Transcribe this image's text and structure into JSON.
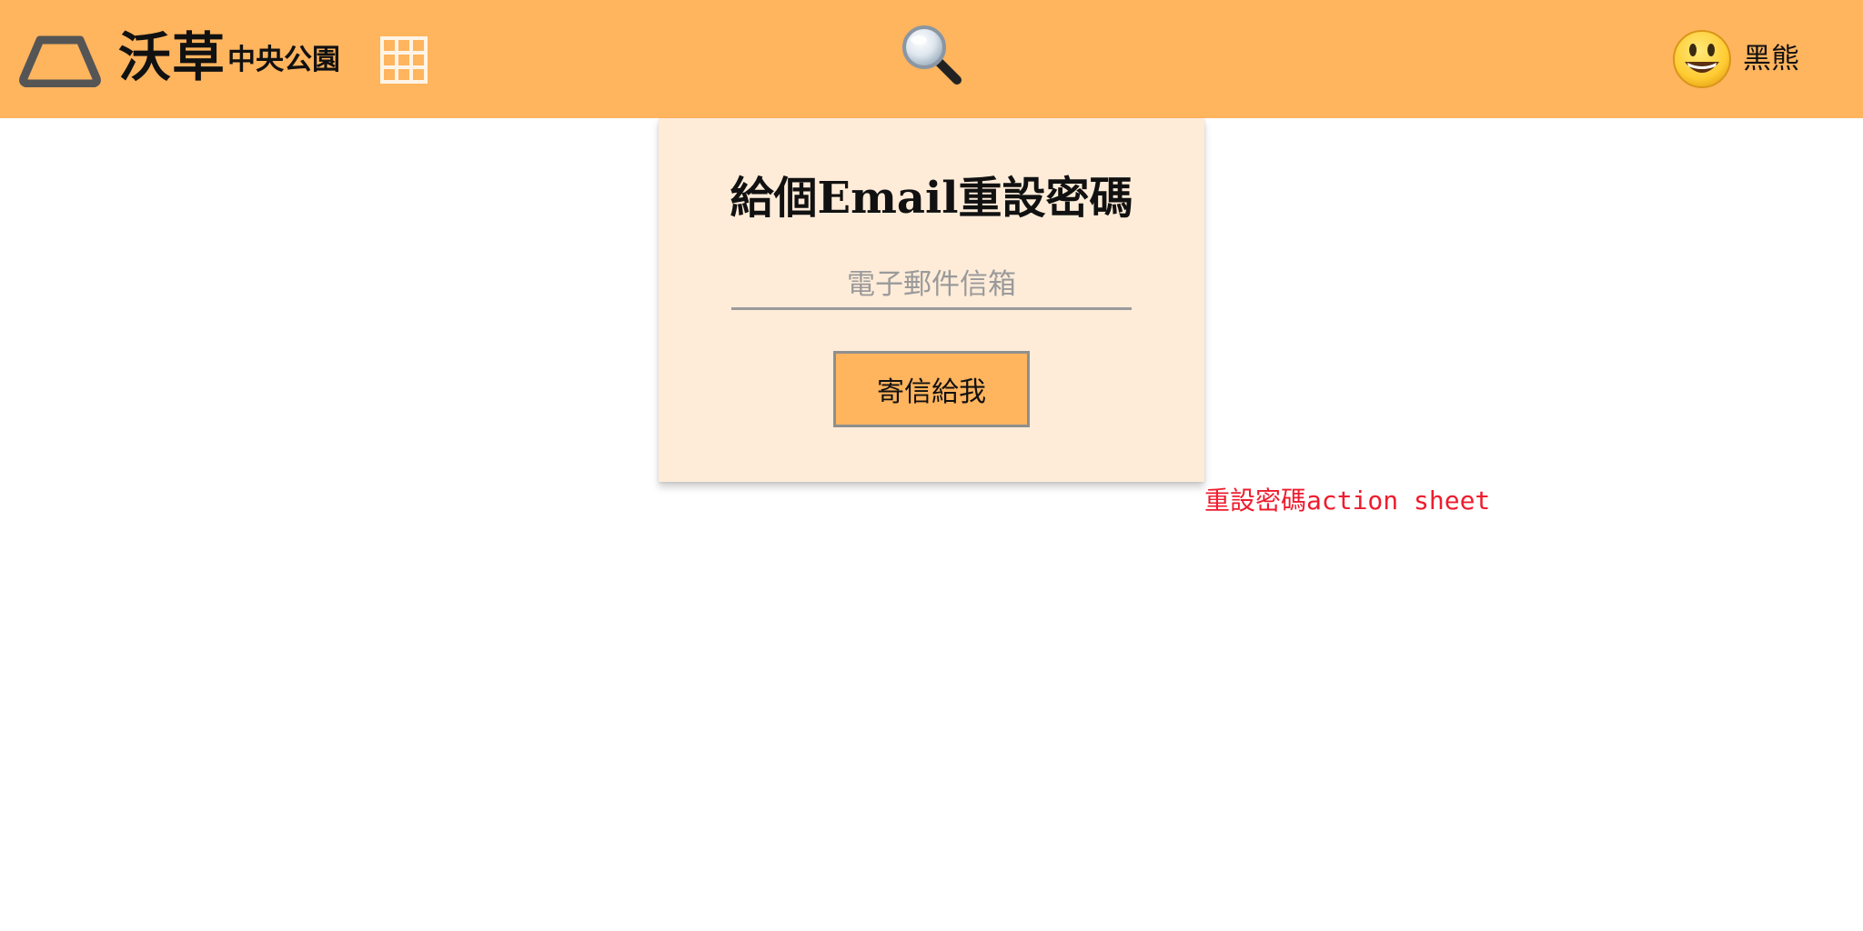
{
  "header": {
    "brand_name": "沃草",
    "brand_sub": "中央公園",
    "logo_icon": "trapezoid-logo-icon",
    "apps_icon": "grid-apps-icon",
    "search_icon": "magnifying-glass-icon",
    "user": {
      "avatar_icon": "grinning-face-icon",
      "name": "黑熊"
    }
  },
  "reset_card": {
    "title": "給個Email重設密碼",
    "email_placeholder": "電子郵件信箱",
    "email_value": "",
    "submit_label": "寄信給我"
  },
  "annotation": "重設密碼action sheet",
  "colors": {
    "header_bg": "#ffb45e",
    "card_bg": "#feecd9",
    "button_bg": "#ffb45e",
    "annotation": "#ee1c2e"
  }
}
